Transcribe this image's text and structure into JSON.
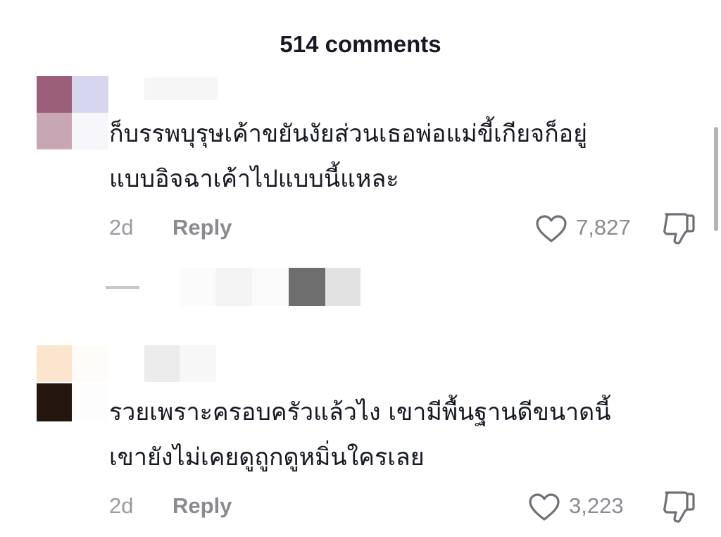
{
  "header": {
    "title": "514 comments"
  },
  "comments": [
    {
      "text_line1": "ก็บรรพบุรุษเค้าขยันงัยส่วนเธอพ่อแม่ขี้เกียจก็อยู่",
      "text_line2": "แบบอิจฉาเค้าไปแบบนี้แหละ",
      "time": "2d",
      "reply_label": "Reply",
      "likes": "7,827"
    },
    {
      "text_line1": "รวยเพราะครอบครัวแล้วไง เขามีพื้นฐานดีขนาดนี้",
      "text_line2": "เขายังไม่เคยดูถูกดูหมิ่นใครเลย",
      "time": "2d",
      "reply_label": "Reply",
      "likes": "3,223"
    }
  ],
  "icons": {
    "like": "heart-outline-icon",
    "dislike": "thumbs-down-outline-icon"
  },
  "colors": {
    "text": "#161823",
    "muted": "#8a8b91"
  }
}
